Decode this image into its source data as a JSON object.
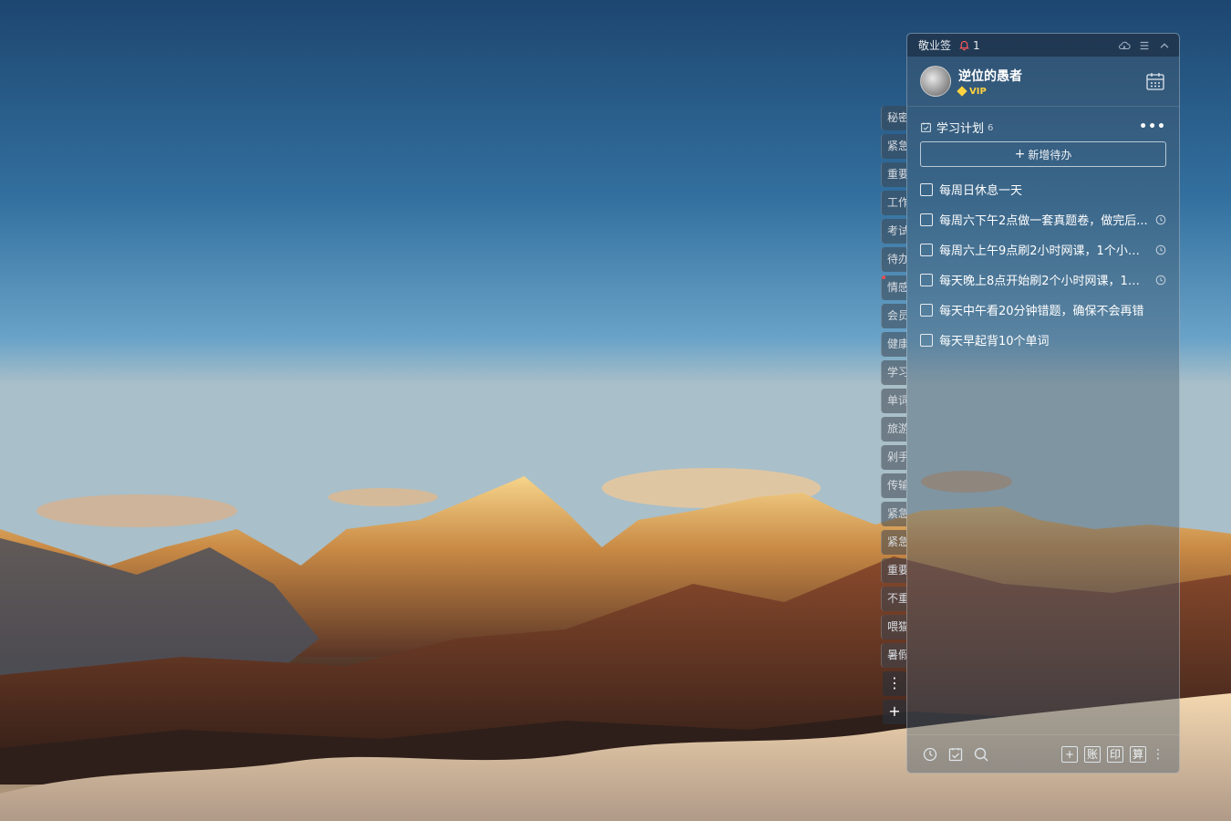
{
  "window": {
    "app_title": "敬业签",
    "notification_count": "1"
  },
  "user": {
    "name": "逆位的愚者",
    "badge": "VIP"
  },
  "tabs": [
    {
      "label": "秘密"
    },
    {
      "label": "紧急"
    },
    {
      "label": "重要"
    },
    {
      "label": "工作"
    },
    {
      "label": "考试"
    },
    {
      "label": "待办"
    },
    {
      "label": "情感"
    },
    {
      "label": "会员"
    },
    {
      "label": "健康"
    },
    {
      "label": "学习"
    },
    {
      "label": "单词"
    },
    {
      "label": "旅游"
    },
    {
      "label": "剁手"
    },
    {
      "label": "传输"
    },
    {
      "label": "紧急"
    },
    {
      "label": "紧急"
    },
    {
      "label": "重要"
    },
    {
      "label": "不重"
    },
    {
      "label": "喂猫"
    },
    {
      "label": "暑假"
    }
  ],
  "tab_actions": {
    "more": "⋮",
    "add": "+"
  },
  "list": {
    "title": "学习计划",
    "count": "6",
    "add_label": "新增待办"
  },
  "todos": [
    {
      "text": "每周日休息一天",
      "has_reminder": false
    },
    {
      "text": "每周六下午2点做一套真题卷，做完后...",
      "has_reminder": true
    },
    {
      "text": "每周六上午9点刷2小时网课，1个小时...",
      "has_reminder": true
    },
    {
      "text": "每天晚上8点开始刷2个小时网课，1个...",
      "has_reminder": true
    },
    {
      "text": "每天中午看20分钟错题，确保不会再错",
      "has_reminder": false
    },
    {
      "text": "每天早起背10个单词",
      "has_reminder": false
    }
  ],
  "footer": {
    "box_labels": [
      "+",
      "账",
      "印",
      "算"
    ]
  },
  "icons": {
    "notification": "bell-icon",
    "cloud": "cloud-sync-icon",
    "menu": "menu-icon",
    "collapse": "chevron-up-icon",
    "calendar": "calendar-icon",
    "list": "checklist-icon",
    "reminder": "clock-icon",
    "search": "search-icon"
  }
}
